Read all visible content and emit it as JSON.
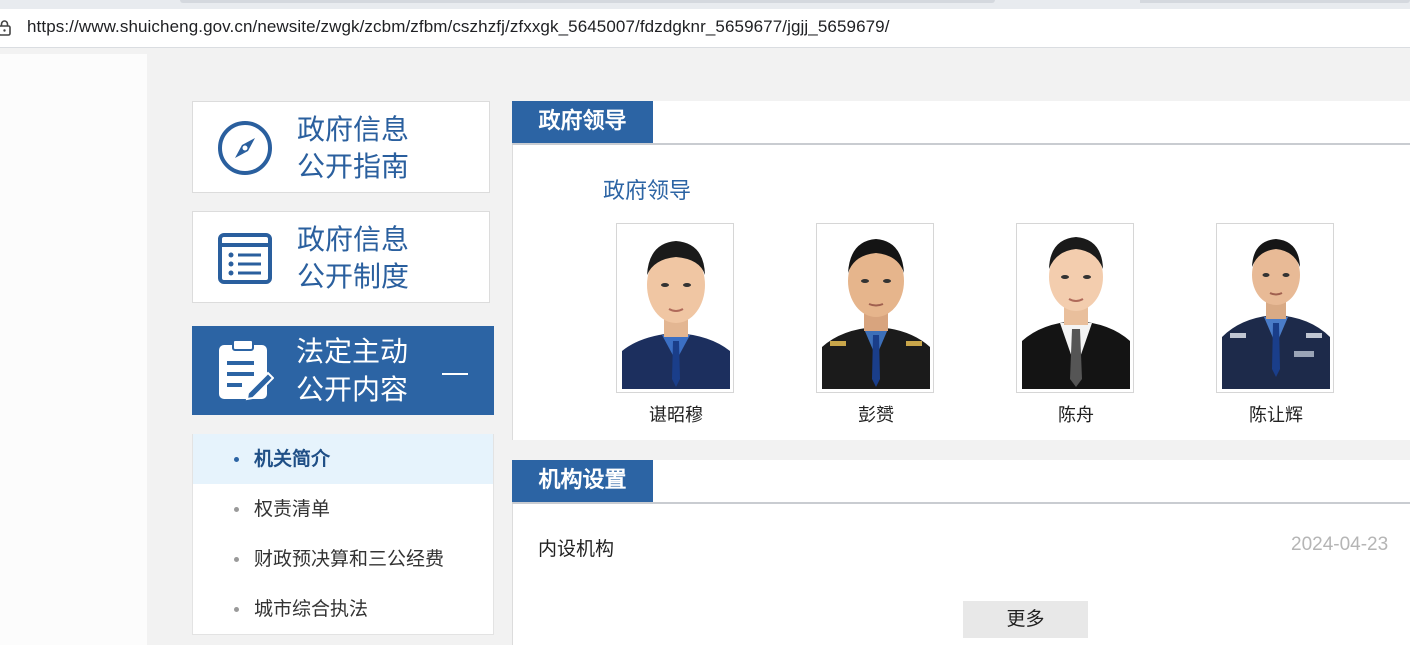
{
  "browser": {
    "url": "https://www.shuicheng.gov.cn/newsite/zwgk/zcbm/zfbm/cszhzfj/zfxxgk_5645007/fdzdgknr_5659677/jgjj_5659679/"
  },
  "sidebar": {
    "cards": [
      {
        "line1": "政府信息",
        "line2": "公开指南",
        "icon": "compass-icon"
      },
      {
        "line1": "政府信息",
        "line2": "公开制度",
        "icon": "list-document-icon"
      }
    ],
    "active_card": {
      "line1": "法定主动",
      "line2": "公开内容",
      "icon": "clipboard-edit-icon",
      "toggle": "—"
    },
    "submenu": [
      {
        "label": "机关简介",
        "active": true
      },
      {
        "label": "权责清单",
        "active": false
      },
      {
        "label": "财政预决算和三公经费",
        "active": false
      },
      {
        "label": "城市综合执法",
        "active": false
      }
    ]
  },
  "main": {
    "leaders_section": {
      "tab": "政府领导",
      "subtitle": "政府领导",
      "leaders": [
        {
          "name": "谌昭穆"
        },
        {
          "name": "彭赟"
        },
        {
          "name": "陈舟"
        },
        {
          "name": "陈让辉"
        }
      ]
    },
    "org_section": {
      "tab": "机构设置",
      "items": [
        {
          "title": "内设机构",
          "date": "2024-04-23"
        }
      ],
      "more_label": "更多"
    }
  },
  "colors": {
    "brand_blue": "#2c64a4",
    "active_submenu_bg": "#e6f3fc",
    "date_gray": "#b5b5b5"
  }
}
